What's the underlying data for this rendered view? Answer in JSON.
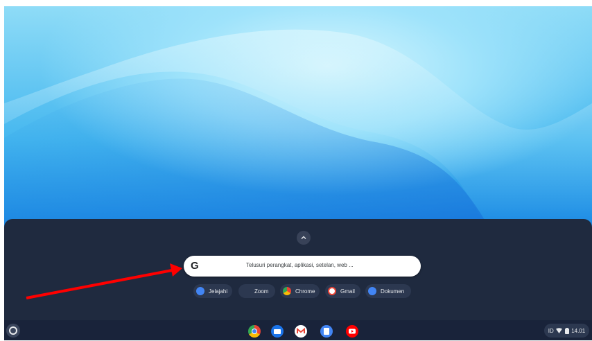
{
  "search": {
    "logo": "G",
    "placeholder": "Telusuri perangkat, aplikasi, setelan, web ..."
  },
  "suggestions": [
    {
      "label": "Jelajahi",
      "icon": "explore-icon",
      "color": "#4285f4"
    },
    {
      "label": "Zoom",
      "icon": "zoom-icon",
      "color": "#2d8cff"
    },
    {
      "label": "Chrome",
      "icon": "chrome-icon",
      "color": "#ea4335"
    },
    {
      "label": "Gmail",
      "icon": "gmail-icon",
      "color": "#ea4335"
    },
    {
      "label": "Dokumen",
      "icon": "docs-icon",
      "color": "#4285f4"
    }
  ],
  "shelf_apps": [
    {
      "name": "chrome-icon"
    },
    {
      "name": "files-icon"
    },
    {
      "name": "gmail-icon"
    },
    {
      "name": "docs-icon"
    },
    {
      "name": "youtube-icon"
    }
  ],
  "tray": {
    "ime": "ID",
    "time": "14.01"
  },
  "colors": {
    "launcher_bg": "#1f2a3f",
    "annotation_arrow": "#ff0000"
  }
}
